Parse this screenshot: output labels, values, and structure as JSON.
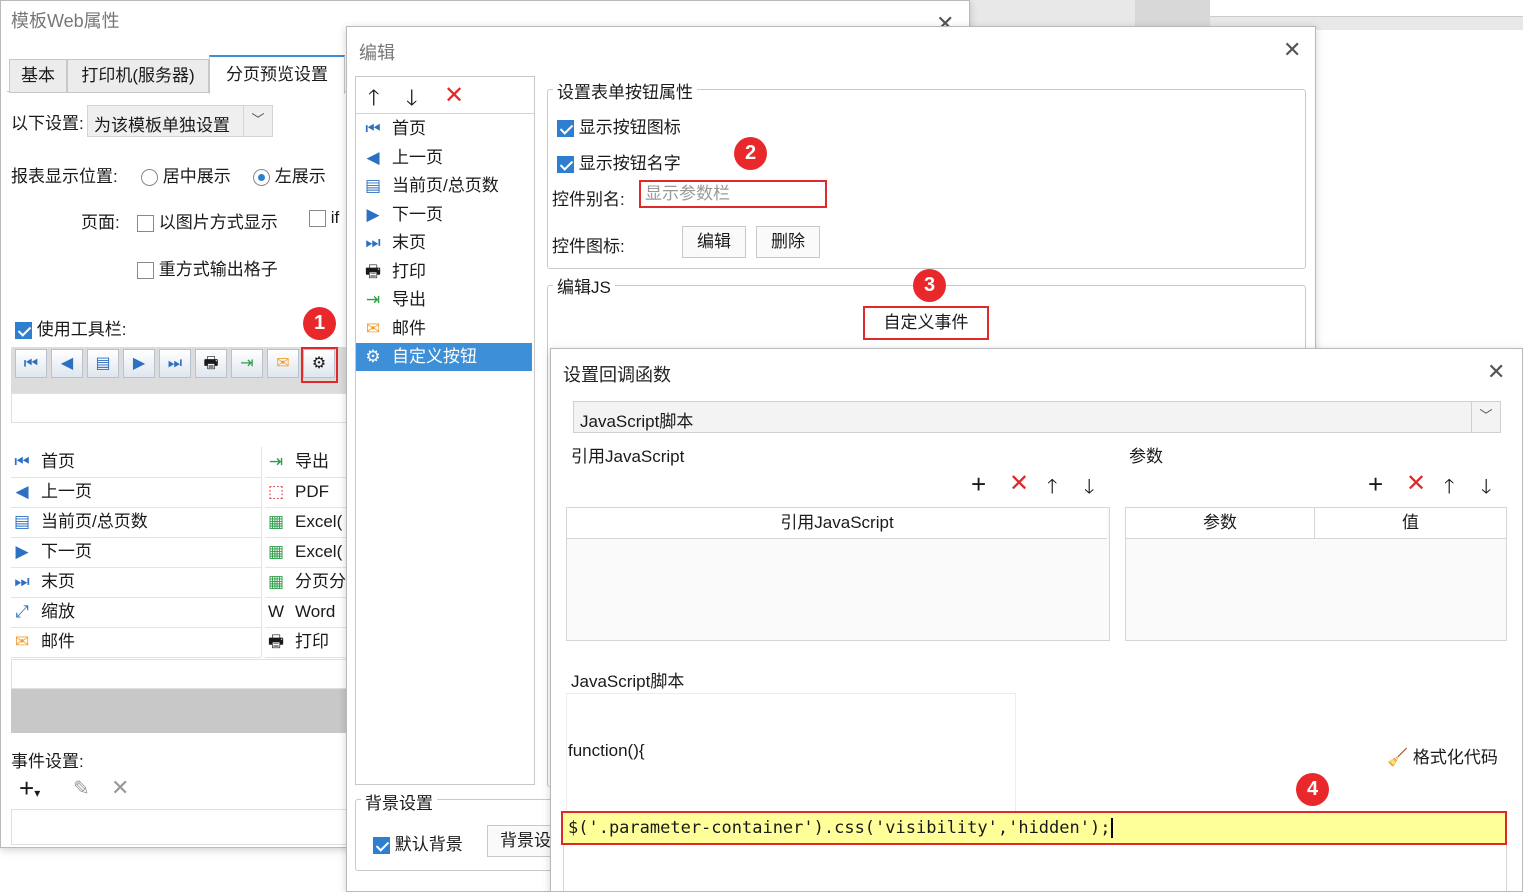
{
  "win1": {
    "title": "模板Web属性",
    "tabs": [
      "基本",
      "打印机(服务器)",
      "分页预览设置"
    ],
    "settings_label": "以下设置:",
    "settings_value": "为该模板单独设置",
    "report_pos_label": "报表显示位置:",
    "report_pos_center": "居中展示",
    "report_pos_left": "左展示",
    "page_label": "页面:",
    "page_opt_image": "以图片方式显示",
    "page_opt_if": "if",
    "page_opt_grid": "重方式输出格子",
    "use_toolbar_label": "使用工具栏:",
    "toolbar_items_left": [
      "首页",
      "上一页",
      "当前页/总页数",
      "下一页",
      "末页",
      "缩放",
      "邮件"
    ],
    "toolbar_items_right": [
      "导出",
      "PDF",
      "Excel(",
      "Excel(",
      "分页分",
      "Word",
      "打印"
    ],
    "event_settings_label": "事件设置:"
  },
  "win2": {
    "title": "编辑",
    "items": [
      "首页",
      "上一页",
      "当前页/总页数",
      "下一页",
      "末页",
      "打印",
      "导出",
      "邮件",
      "自定义按钮"
    ],
    "group_title": "设置表单按钮属性",
    "show_icon_label": "显示按钮图标",
    "show_name_label": "显示按钮名字",
    "alias_label": "控件别名:",
    "alias_value": "显示参数栏",
    "icon_label": "控件图标:",
    "edit_btn": "编辑",
    "delete_btn": "删除",
    "edit_js_label": "编辑JS",
    "custom_event_btn": "自定义事件",
    "bg_group": "背景设置",
    "default_bg_label": "默认背景",
    "bg_set_btn": "背景设"
  },
  "win3": {
    "title": "设置回调函数",
    "type_value": "JavaScript脚本",
    "ref_js_label": "引用JavaScript",
    "ref_js_col": "引用JavaScript",
    "params_label": "参数",
    "params_col": "参数",
    "value_col": "值",
    "script_label": "JavaScript脚本",
    "func_line": "function(){",
    "format_code": "格式化代码",
    "code_line": "$('.parameter-container').css('visibility','hidden');"
  },
  "badges": [
    "1",
    "2",
    "3",
    "4"
  ],
  "colors": {
    "highlight": "#e0292b",
    "selection": "#3d8fd8",
    "code_bg": "#ffff99"
  }
}
